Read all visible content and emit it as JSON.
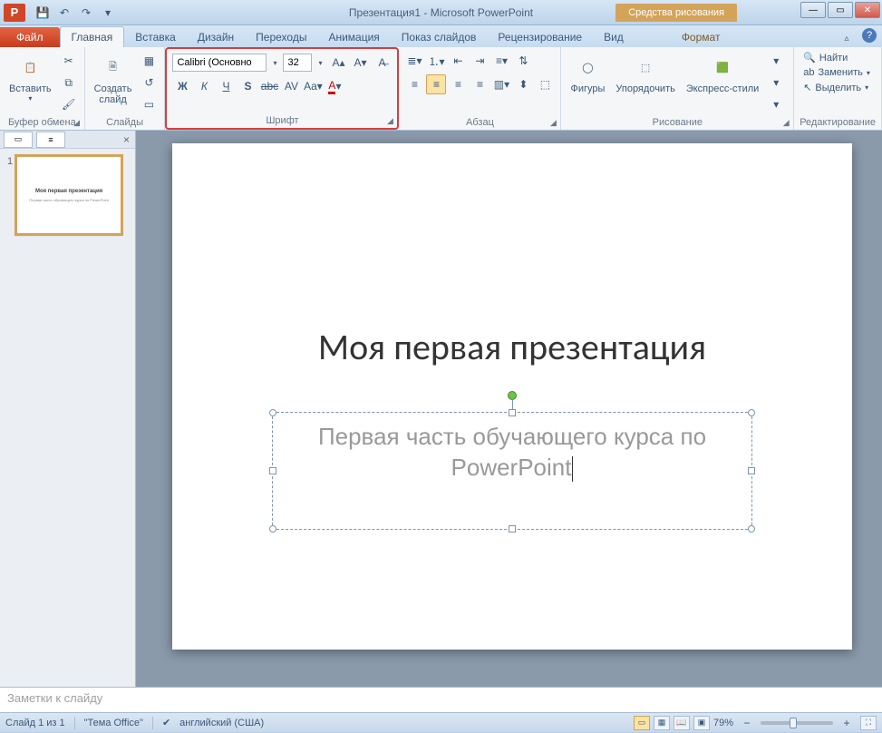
{
  "titlebar": {
    "app_letter": "P",
    "title": "Презентация1 - Microsoft PowerPoint",
    "context_tools": "Средства рисования"
  },
  "tabs": {
    "file": "Файл",
    "items": [
      "Главная",
      "Вставка",
      "Дизайн",
      "Переходы",
      "Анимация",
      "Показ слайдов",
      "Рецензирование",
      "Вид"
    ],
    "context": "Формат",
    "active_index": 0
  },
  "ribbon": {
    "clipboard": {
      "label": "Буфер обмена",
      "paste": "Вставить"
    },
    "slides": {
      "label": "Слайды",
      "new_slide": "Создать\nслайд"
    },
    "font": {
      "label": "Шрифт",
      "name": "Calibri (Основно",
      "size": "32"
    },
    "paragraph": {
      "label": "Абзац"
    },
    "drawing": {
      "label": "Рисование",
      "shapes": "Фигуры",
      "arrange": "Упорядочить",
      "styles": "Экспресс-стили"
    },
    "editing": {
      "label": "Редактирование",
      "find": "Найти",
      "replace": "Заменить",
      "select": "Выделить"
    }
  },
  "thumbnail": {
    "num": "1",
    "title": "Моя первая презентация",
    "sub": "Первая часть обучающего курса по PowerPoint"
  },
  "slide": {
    "title": "Моя первая презентация",
    "subtitle": "Первая часть обучающего курса по PowerPoint"
  },
  "notes": {
    "placeholder": "Заметки к слайду"
  },
  "status": {
    "slide_info": "Слайд 1 из 1",
    "theme": "\"Тема Office\"",
    "language": "английский (США)",
    "zoom": "79%"
  }
}
